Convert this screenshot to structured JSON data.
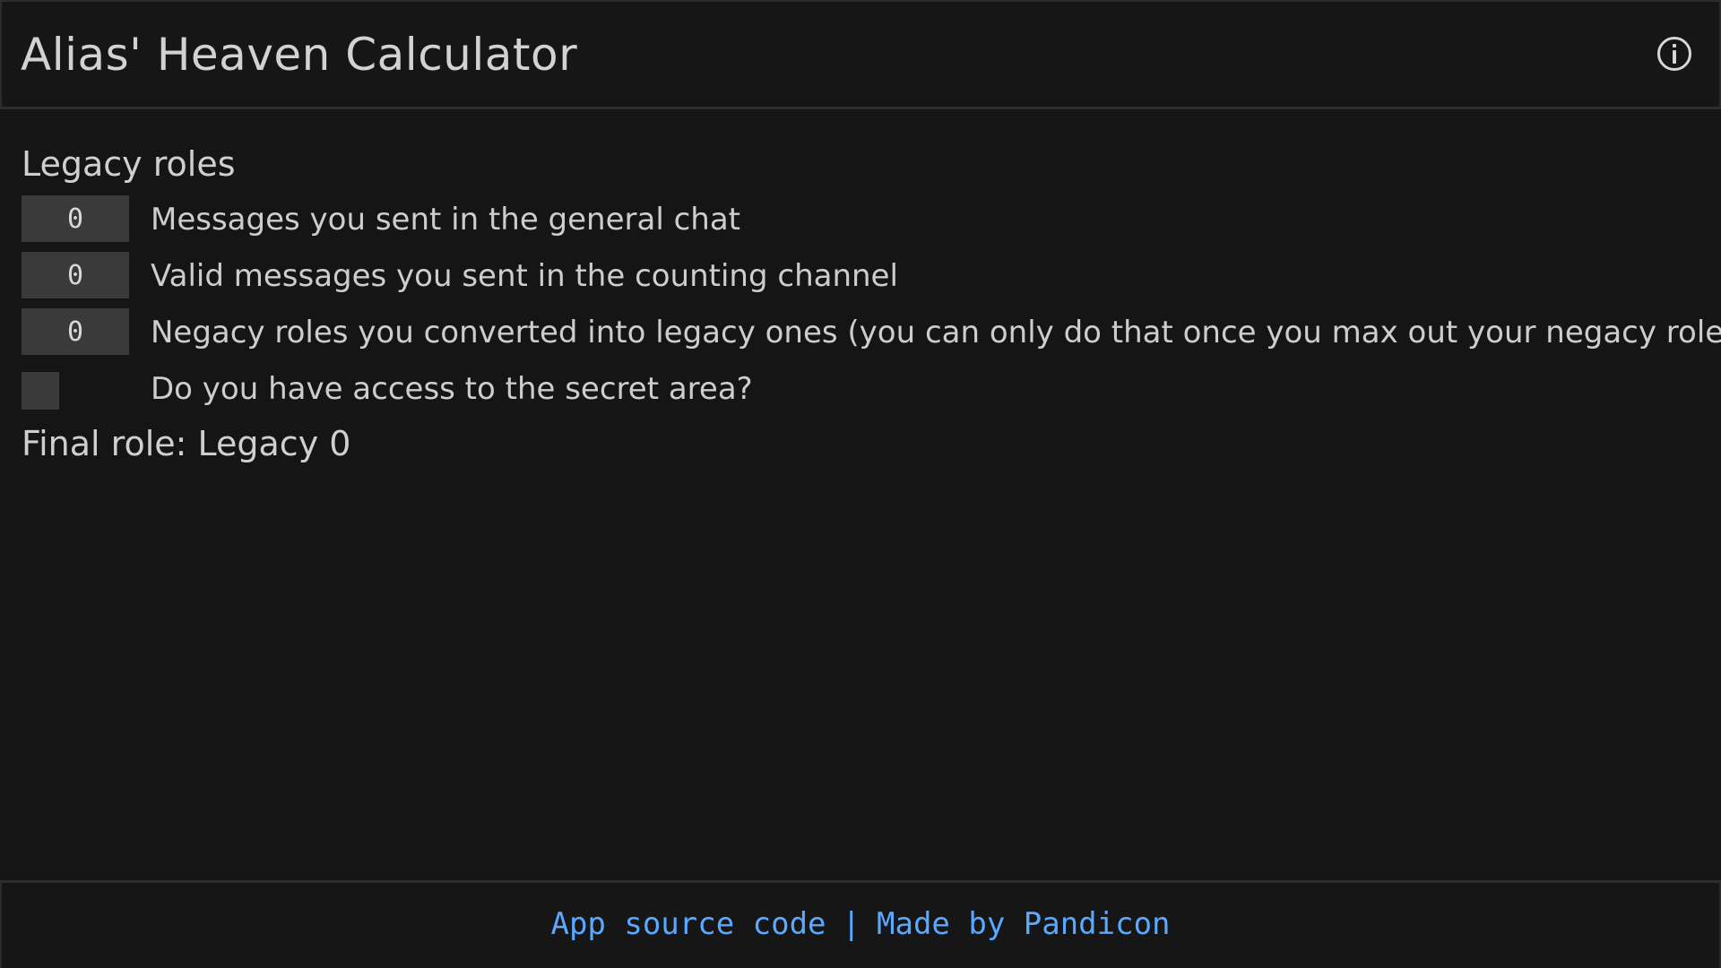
{
  "header": {
    "title": "Alias' Heaven Calculator",
    "info_icon": "info-circle-icon"
  },
  "legacy": {
    "section_title": "Legacy roles",
    "fields": [
      {
        "value": "0",
        "label": "Messages you sent in the general chat"
      },
      {
        "value": "0",
        "label": "Valid messages you sent in the counting channel"
      },
      {
        "value": "0",
        "label": "Negacy roles you converted into legacy ones (you can only do that once you max out your negacy roles)"
      }
    ],
    "secret_area": {
      "checked": false,
      "label": "Do you have access to the secret area?"
    },
    "final_role": "Final role: Legacy 0"
  },
  "footer": {
    "source_link": "App source code",
    "separator": "|",
    "credit_link": "Made by Pandicon"
  },
  "colors": {
    "background": "#151515",
    "panel": "#161616",
    "input": "#3a3a3a",
    "text": "#cfcfcf",
    "link": "#5aa8ff"
  }
}
